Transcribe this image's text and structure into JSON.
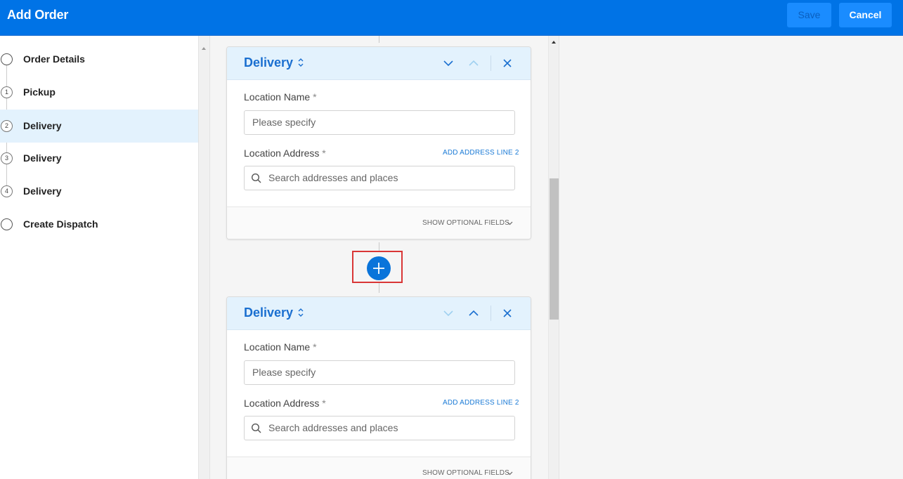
{
  "header": {
    "title": "Add Order",
    "save_label": "Save",
    "cancel_label": "Cancel"
  },
  "sidebar": {
    "steps": [
      {
        "label": "Order Details",
        "marker": ""
      },
      {
        "label": "Pickup",
        "marker": "1"
      },
      {
        "label": "Delivery",
        "marker": "2",
        "active": true
      },
      {
        "label": "Delivery",
        "marker": "3"
      },
      {
        "label": "Delivery",
        "marker": "4"
      },
      {
        "label": "Create Dispatch",
        "marker": ""
      }
    ]
  },
  "cards": [
    {
      "title": "Delivery",
      "location_name_label": "Location Name",
      "required_mark": "*",
      "location_name_placeholder": "Please specify",
      "location_address_label": "Location Address",
      "add_address_line": "ADD ADDRESS LINE 2",
      "address_placeholder": "Search addresses and places",
      "show_optional": "SHOW OPTIONAL FIELDS"
    },
    {
      "title": "Delivery",
      "location_name_label": "Location Name",
      "required_mark": "*",
      "location_name_placeholder": "Please specify",
      "location_address_label": "Location Address",
      "add_address_line": "ADD ADDRESS LINE 2",
      "address_placeholder": "Search addresses and places",
      "show_optional": "SHOW OPTIONAL FIELDS"
    }
  ],
  "colors": {
    "brand": "#0073e6",
    "accent": "#1a6fd0",
    "add_button": "#0a74da",
    "highlight_box": "#d93636"
  }
}
